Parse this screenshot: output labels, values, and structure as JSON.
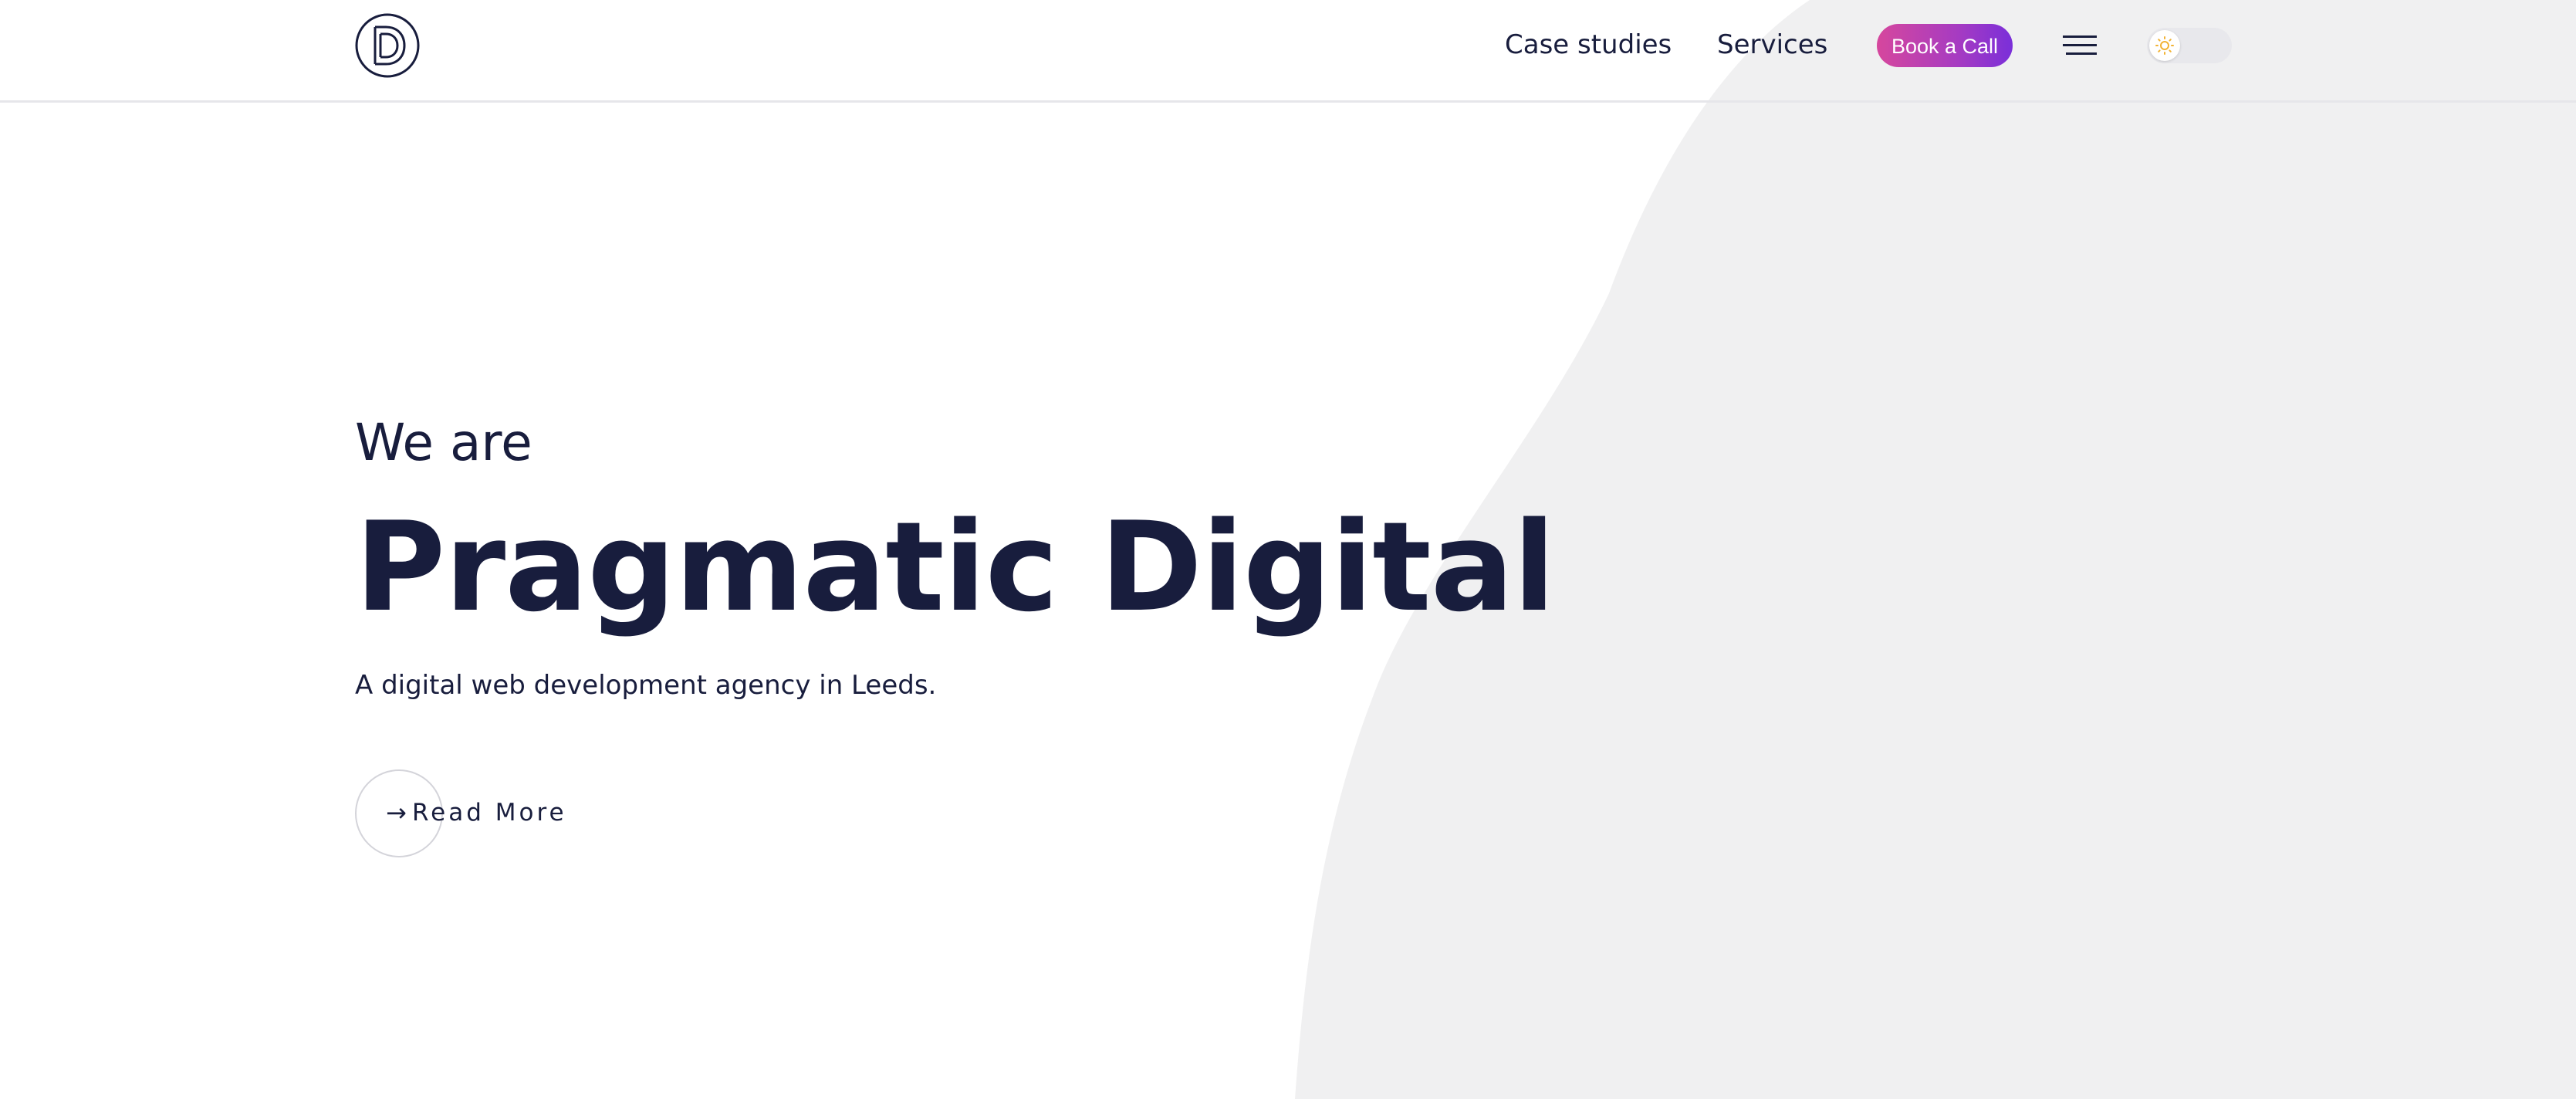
{
  "header": {
    "nav": {
      "case_studies": "Case studies",
      "services": "Services"
    },
    "cta_label": "Book a Call",
    "menu_icon": "hamburger-icon",
    "theme_toggle": {
      "icon": "sun-icon",
      "state": "light"
    }
  },
  "hero": {
    "intro": "We are",
    "headline": "Pragmatic Digital",
    "tagline": "A digital web development agency in Leeds.",
    "read_more": {
      "arrow": "→",
      "label": "Read More"
    }
  },
  "colors": {
    "text": "#181d3d",
    "background": "#ffffff",
    "shape": "#f0f0f1",
    "cta_gradient_start": "#d6479d",
    "cta_gradient_end": "#7a2fd9"
  }
}
